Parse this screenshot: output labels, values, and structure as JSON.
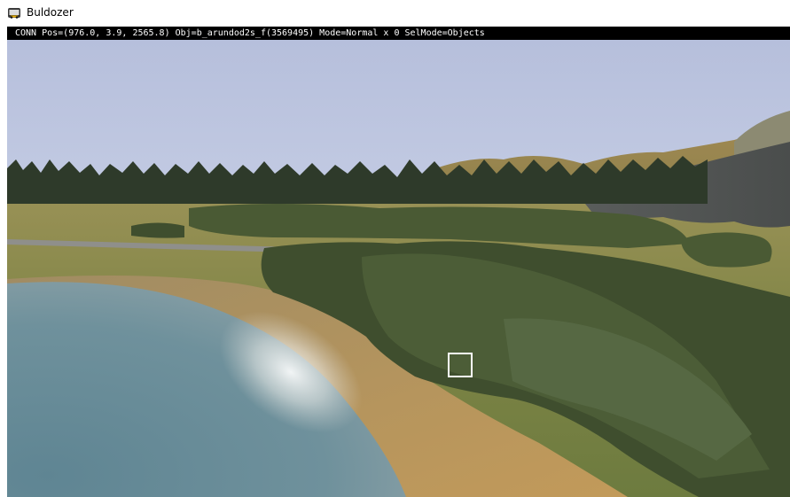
{
  "window": {
    "title": "Buldozer",
    "icon": "bulldozer-app-icon"
  },
  "viewport": {
    "status_text": "CONN Pos=(976.0, 3.9, 2565.8) Obj=b_arundod2s_f(3569495) Mode=Normal x 0 SelMode=Objects"
  },
  "colors": {
    "sky": "#b8c1de",
    "terrain": "#8a8a4e",
    "water": "#6d8e99",
    "sand": "#b39564",
    "road": "#8c8c8c",
    "status_bg": "#000000",
    "cursor": "#ffffff"
  }
}
